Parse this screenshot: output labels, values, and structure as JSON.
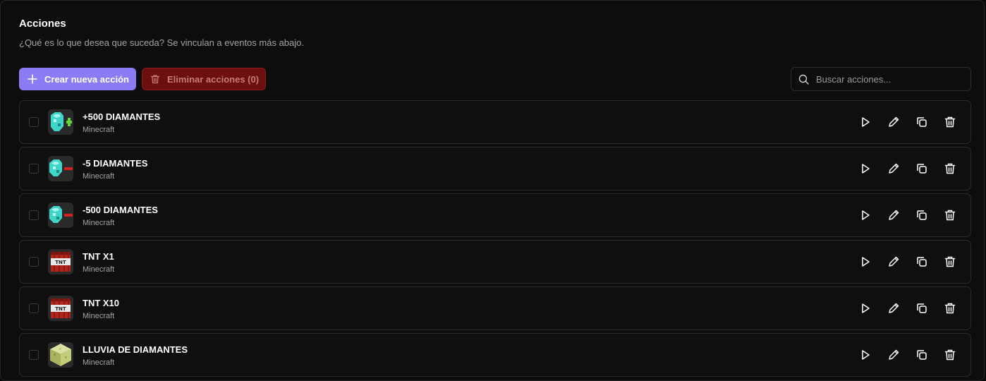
{
  "header": {
    "title": "Acciones",
    "subtitle": "¿Qué es lo que desea que suceda? Se vinculan a eventos más abajo."
  },
  "toolbar": {
    "create_label": "Crear nueva acción",
    "delete_label": "Eliminar acciones (0)",
    "search_placeholder": "Buscar acciones..."
  },
  "colors": {
    "accent": "#8b7cf6",
    "danger": "#6b0f0f"
  },
  "actions": [
    {
      "name": "+500 DIAMANTES",
      "source": "Minecraft",
      "icon": "diamond-plus-icon"
    },
    {
      "name": "-5 DIAMANTES",
      "source": "Minecraft",
      "icon": "diamond-minus-icon"
    },
    {
      "name": "-500 DIAMANTES",
      "source": "Minecraft",
      "icon": "diamond-minus-icon"
    },
    {
      "name": "TNT X1",
      "source": "Minecraft",
      "icon": "tnt-icon"
    },
    {
      "name": "TNT X10",
      "source": "Minecraft",
      "icon": "tnt-icon"
    },
    {
      "name": "LLUVIA DE DIAMANTES",
      "source": "Minecraft",
      "icon": "sponge-block-icon"
    }
  ]
}
